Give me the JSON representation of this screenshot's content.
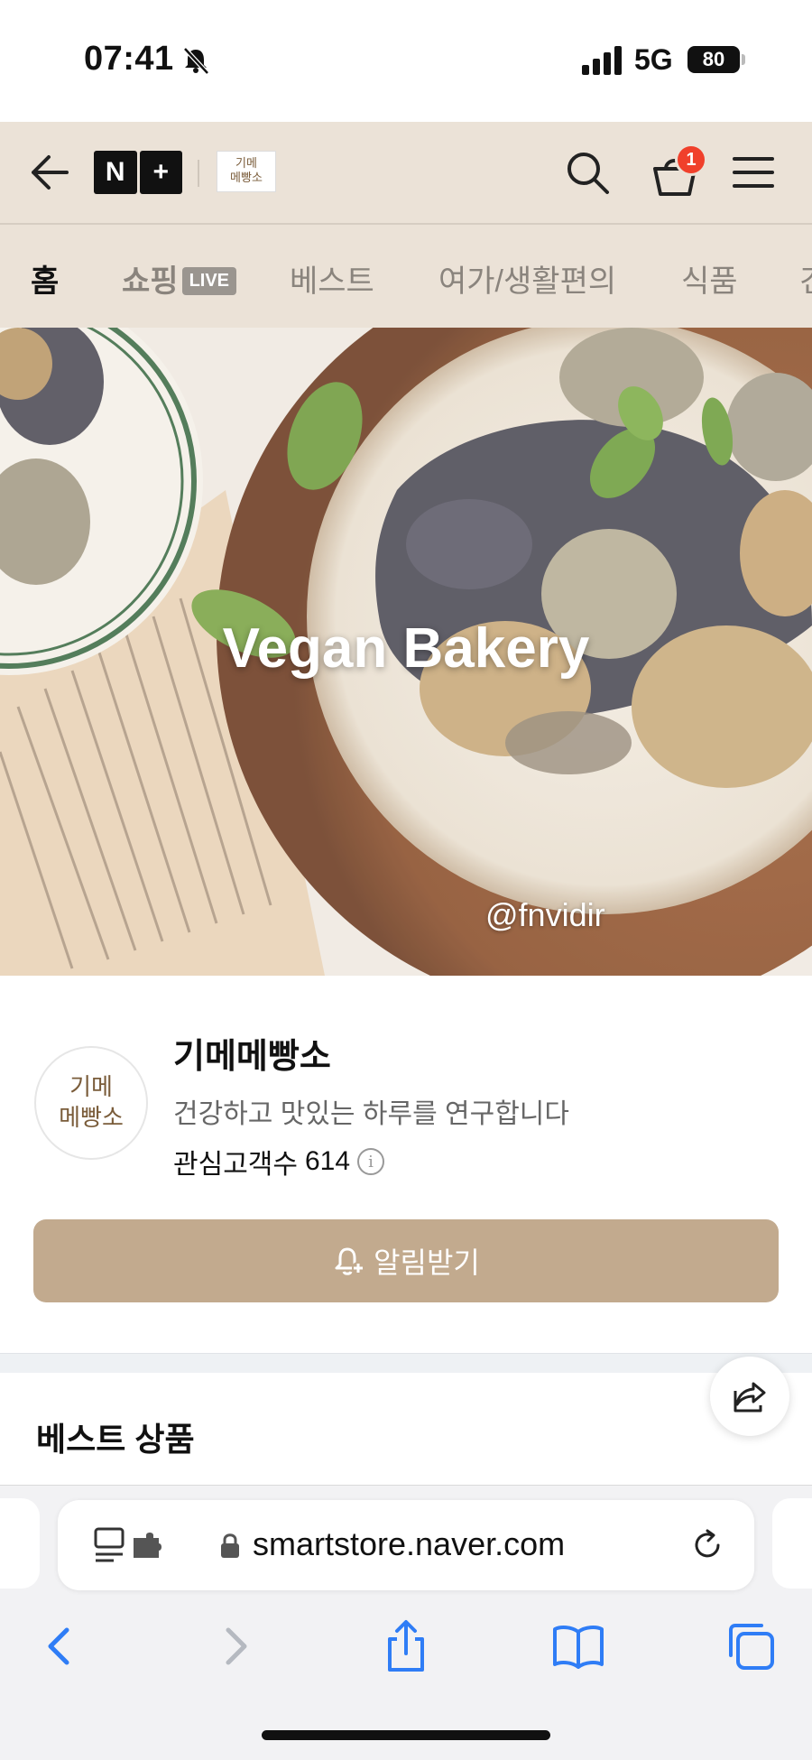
{
  "status_bar": {
    "time": "07:41",
    "network": "5G",
    "battery": "80"
  },
  "header": {
    "brand_letters": [
      "N",
      "+"
    ],
    "store_logo_lines": [
      "기메",
      "메빵소"
    ],
    "cart_count": "1"
  },
  "tabs": [
    {
      "label": "홈",
      "active": true
    },
    {
      "label": "쇼핑",
      "badge": "LIVE"
    },
    {
      "label": "베스트"
    },
    {
      "label": "여가/생활편의"
    },
    {
      "label": "식품"
    },
    {
      "label": "건"
    }
  ],
  "banner": {
    "title": "Vegan Bakery",
    "credit": "@fnvidir"
  },
  "store": {
    "avatar_lines": [
      "기메",
      "메빵소"
    ],
    "name": "기메메빵소",
    "description": "건강하고 맛있는 하루를 연구합니다",
    "followers_label": "관심고객수",
    "followers_count": "614",
    "alert_button": "알림받기"
  },
  "best": {
    "title": "베스트 상품"
  },
  "browser": {
    "url": "smartstore.naver.com"
  },
  "colors": {
    "header_bg": "#ebe2d7",
    "accent_button": "#c2aa8e",
    "badge_red": "#f0402b",
    "ios_blue": "#2f7df6"
  }
}
